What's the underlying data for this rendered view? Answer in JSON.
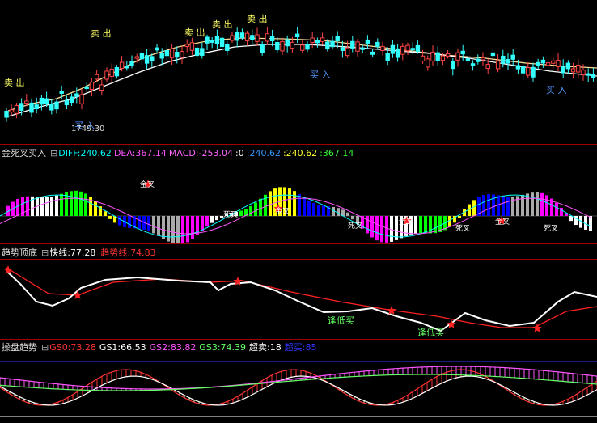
{
  "main": {
    "sell_label": "卖 出",
    "buy_label": "买 入",
    "low_price": "1749.30"
  },
  "macd": {
    "title": "金死叉买入",
    "diff": "DIFF:240.62",
    "dea": "DEA:367.14",
    "macd": "MACD:-253.04",
    "zero": ":0",
    "v1": ":240.62",
    "v2": ":240.62",
    "v3": ":367.14",
    "cross_label": "金叉",
    "dead_label": "死叉",
    "colors": {
      "diff": "#00ffff",
      "dea": "#ff00ff",
      "macd": "#ff5555",
      "zero": "#ffffff",
      "v1": "#0080ff",
      "v2": "#ffff00",
      "v3": "#00ff00"
    }
  },
  "trend": {
    "title": "趋势顶底",
    "fast": "快线:77.28",
    "trend_line": "趋势线:74.83",
    "bottom_label": "逢低买"
  },
  "ops": {
    "title": "操盘趋势",
    "gs0": "GS0:73.28",
    "gs1": "GS1:66.53",
    "gs2": "GS2:83.82",
    "gs3": "GS3:74.39",
    "overbought": "超卖:18",
    "oversold": "超买:85"
  }
}
